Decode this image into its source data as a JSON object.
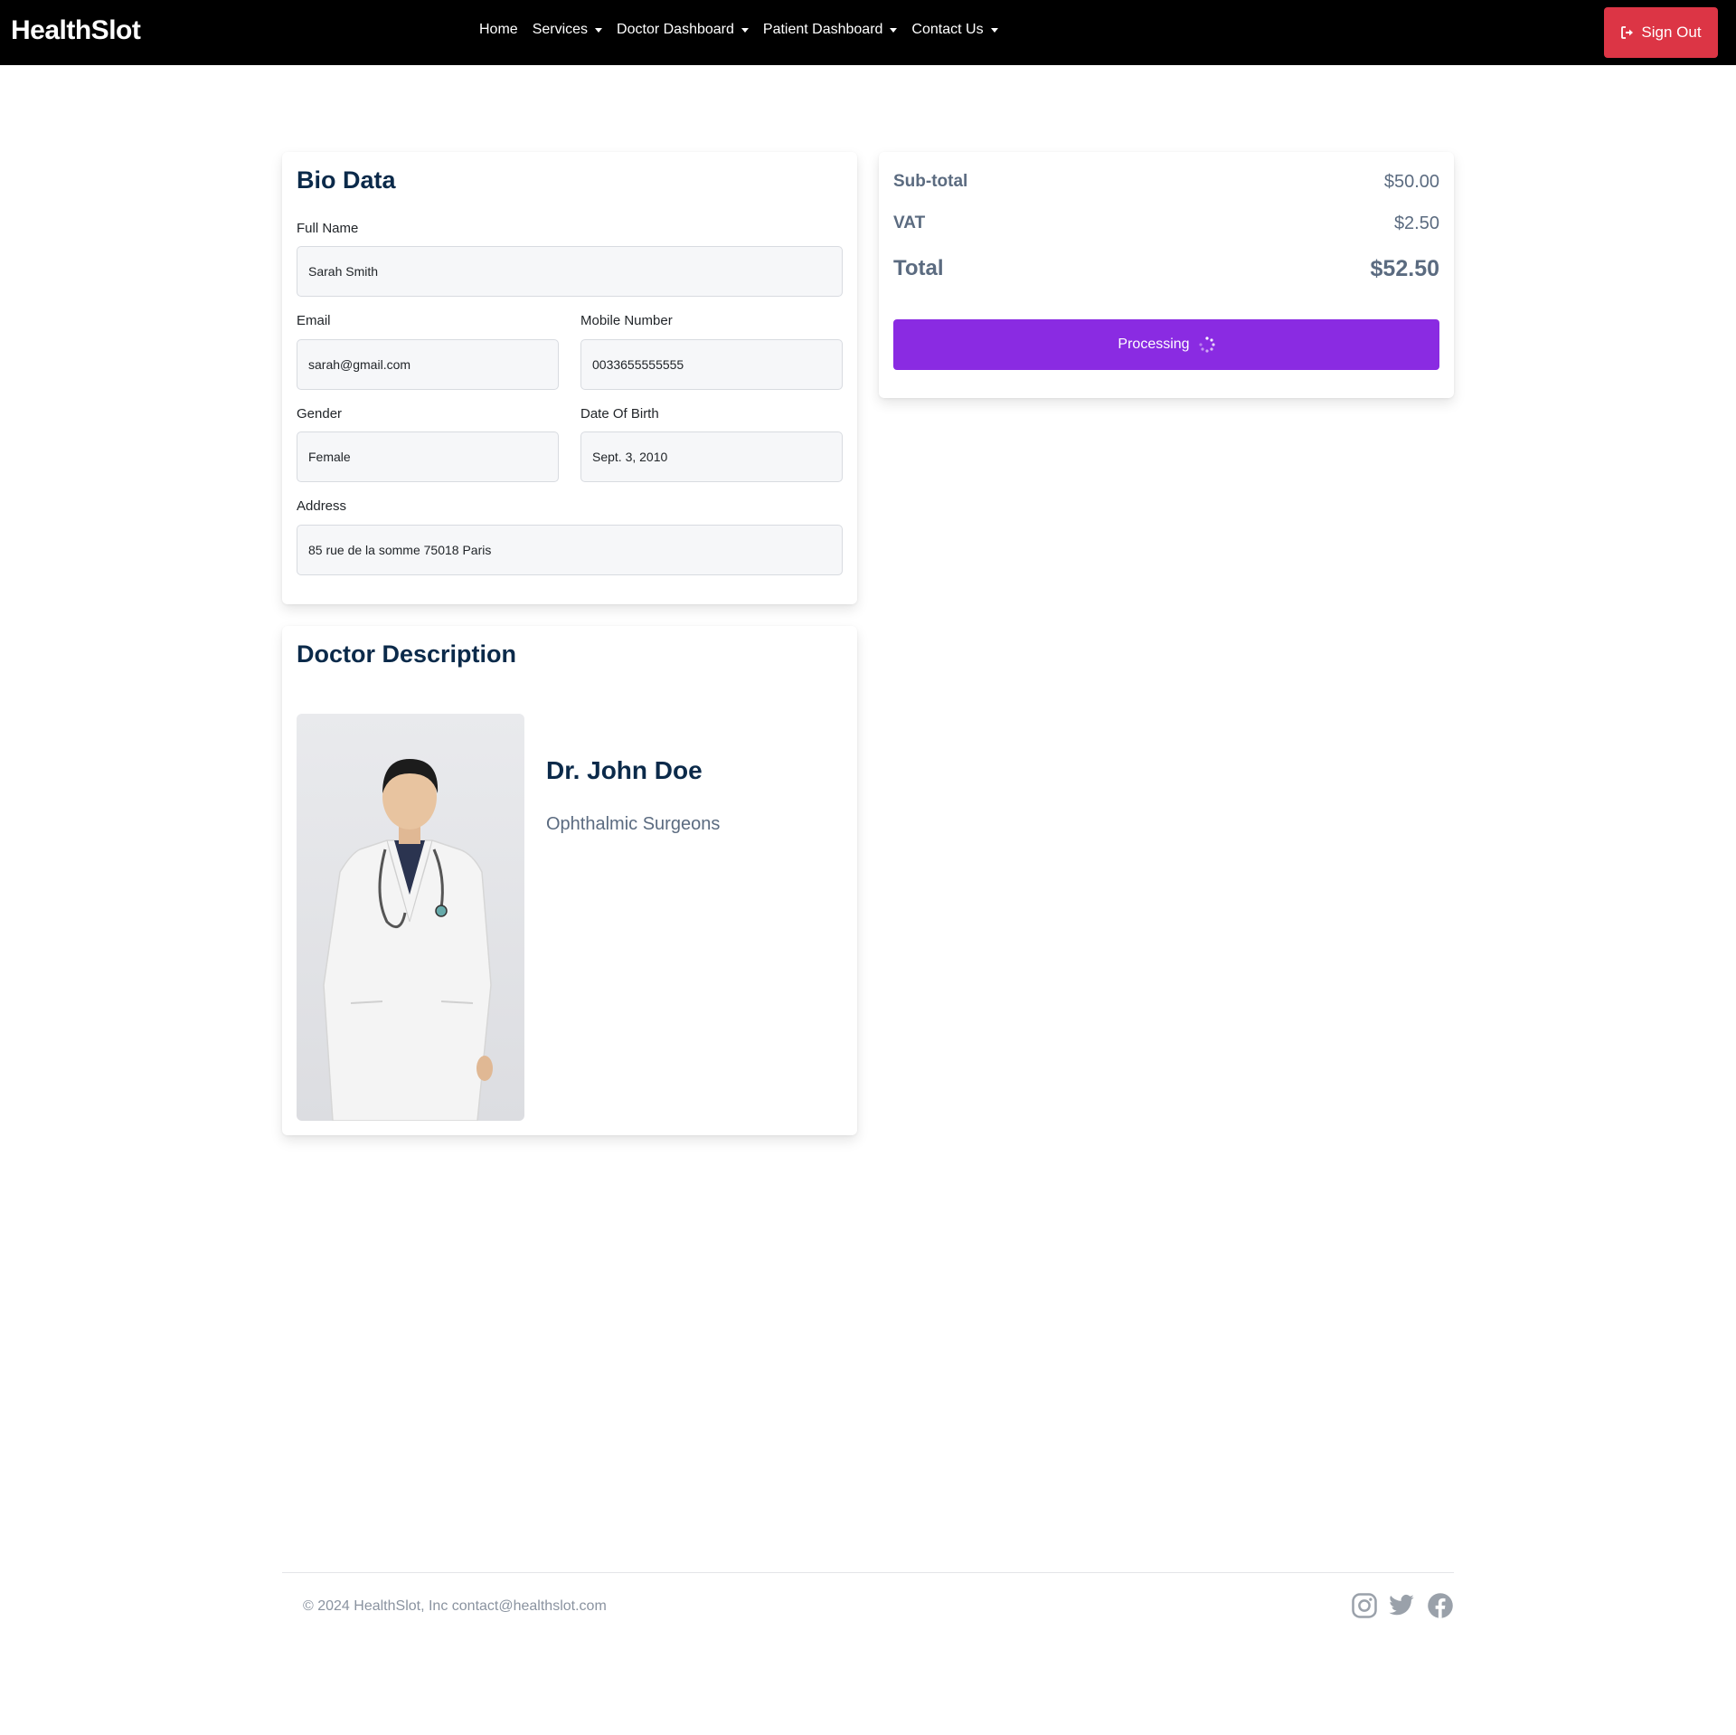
{
  "nav": {
    "brand": "HealthSlot",
    "links": [
      {
        "label": "Home",
        "dropdown": false
      },
      {
        "label": "Services",
        "dropdown": true
      },
      {
        "label": "Doctor Dashboard",
        "dropdown": true
      },
      {
        "label": "Patient Dashboard",
        "dropdown": true
      },
      {
        "label": "Contact Us",
        "dropdown": true
      }
    ],
    "signout_label": "Sign Out",
    "signout_icon": "sign-out-icon",
    "signout_color": "#dc3545"
  },
  "bio": {
    "title": "Bio Data",
    "full_name": {
      "label": "Full Name",
      "value": "Sarah Smith"
    },
    "email": {
      "label": "Email",
      "value": "sarah@gmail.com"
    },
    "mobile": {
      "label": "Mobile Number",
      "value": "0033655555555"
    },
    "gender": {
      "label": "Gender",
      "value": "Female"
    },
    "dob": {
      "label": "Date Of Birth",
      "value": "Sept. 3, 2010"
    },
    "address": {
      "label": "Address",
      "value": "85 rue de la somme 75018 Paris"
    }
  },
  "doctor": {
    "title": "Doctor Description",
    "name": "Dr. John Doe",
    "specialty": "Ophthalmic Surgeons",
    "photo": "doctor-photo"
  },
  "summary": {
    "subtotal_label": "Sub-total",
    "subtotal_value": "$50.00",
    "vat_label": "VAT",
    "vat_value": "$2.50",
    "total_label": "Total",
    "total_value": "$52.50",
    "button_label": "Processing",
    "button_color": "#8a2be2"
  },
  "footer": {
    "copyright": "© 2024 HealthSlot, Inc contact@healthslot.com",
    "social": [
      "instagram-icon",
      "twitter-icon",
      "facebook-icon"
    ]
  }
}
